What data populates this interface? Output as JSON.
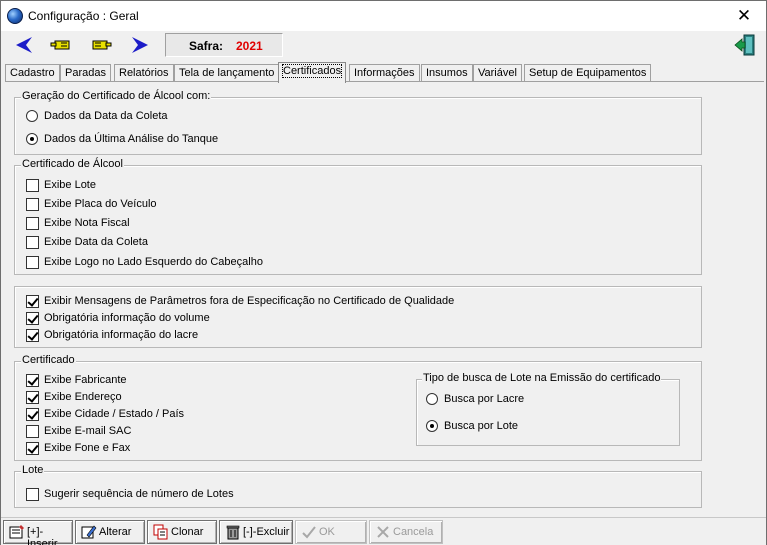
{
  "window": {
    "title": "Configuração : Geral"
  },
  "toolbar": {
    "safra_label": "Safra:",
    "safra_value": "2021"
  },
  "tabs": [
    "Cadastro",
    "Paradas",
    "Relatórios",
    "Tela de lançamento",
    "Certificados",
    "Informações",
    "Insumos",
    "Variável",
    "Setup de Equipamentos"
  ],
  "active_tab": "Certificados",
  "geracao": {
    "title": "Geração do Certificado de Álcool com:",
    "options": [
      {
        "label": "Dados da Data da Coleta",
        "checked": false
      },
      {
        "label": "Dados da Última Análise do Tanque",
        "checked": true
      }
    ]
  },
  "cert_alcool": {
    "title": "Certificado de Álcool",
    "items": [
      {
        "label": "Exibe Lote",
        "checked": false
      },
      {
        "label": "Exibe Placa do Veículo",
        "checked": false
      },
      {
        "label": "Exibe Nota Fiscal",
        "checked": false
      },
      {
        "label": "Exibe Data da Coleta",
        "checked": false
      },
      {
        "label": "Exibe Logo no Lado Esquerdo do Cabeçalho",
        "checked": false
      }
    ]
  },
  "qualidade": {
    "items": [
      {
        "label": "Exibir Mensagens de Parâmetros fora de Especificação no Certificado de Qualidade",
        "checked": true
      },
      {
        "label": "Obrigatória informação do volume",
        "checked": true
      },
      {
        "label": "Obrigatória informação do lacre",
        "checked": true
      }
    ]
  },
  "certificado": {
    "title": "Certificado",
    "items": [
      {
        "label": "Exibe Fabricante",
        "checked": true
      },
      {
        "label": "Exibe Endereço",
        "checked": true
      },
      {
        "label": "Exibe Cidade / Estado / País",
        "checked": true
      },
      {
        "label": "Exibe E-mail SAC",
        "checked": false
      },
      {
        "label": "Exibe Fone e Fax",
        "checked": true
      }
    ],
    "busca": {
      "title": "Tipo de busca de Lote na Emissão do certificado",
      "options": [
        {
          "label": "Busca por Lacre",
          "checked": false
        },
        {
          "label": "Busca por Lote",
          "checked": true
        }
      ]
    }
  },
  "lote": {
    "title": "Lote",
    "items": [
      {
        "label": "Sugerir sequência de número de Lotes",
        "checked": false
      }
    ]
  },
  "buttons": {
    "inserir": "[+]-Inserir",
    "alterar": "Alterar",
    "clonar": "Clonar",
    "excluir": "[-]-Excluir",
    "ok": "OK",
    "cancela": "Cancela"
  },
  "colors": {
    "safra_value": "#e00000",
    "nav_arrow": "#1c1cc8",
    "hand_icon": "#e8e000"
  }
}
